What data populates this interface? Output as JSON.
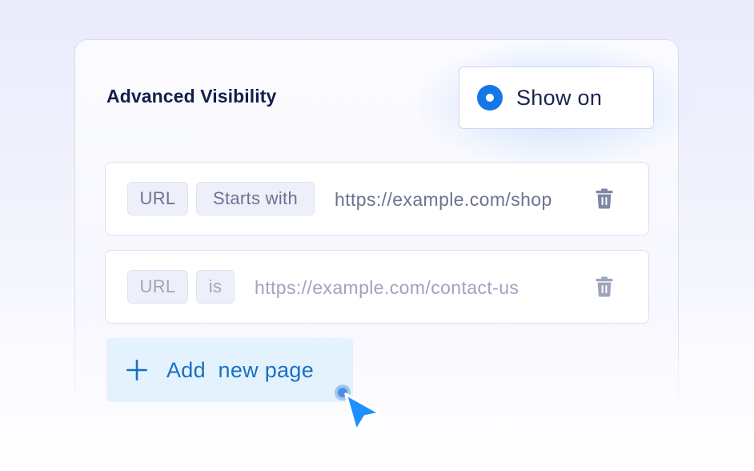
{
  "panel": {
    "title": "Advanced Visibility",
    "visibility_toggle": {
      "label": "Show on",
      "selected": true,
      "accent_color": "#1477e8"
    }
  },
  "rules": [
    {
      "field": "URL",
      "operator": "Starts with",
      "value": "https://example.com/shop",
      "delete_icon": "trash-icon"
    },
    {
      "field": "URL",
      "operator": "is",
      "value": "https://example.com/contact-us",
      "delete_icon": "trash-icon"
    }
  ],
  "add_button": {
    "label": "Add  new page",
    "icon": "plus-icon",
    "color": "#1a6fc4"
  },
  "cursor": {
    "icon": "pointer-arrow-icon",
    "color": "#1e90ff"
  }
}
